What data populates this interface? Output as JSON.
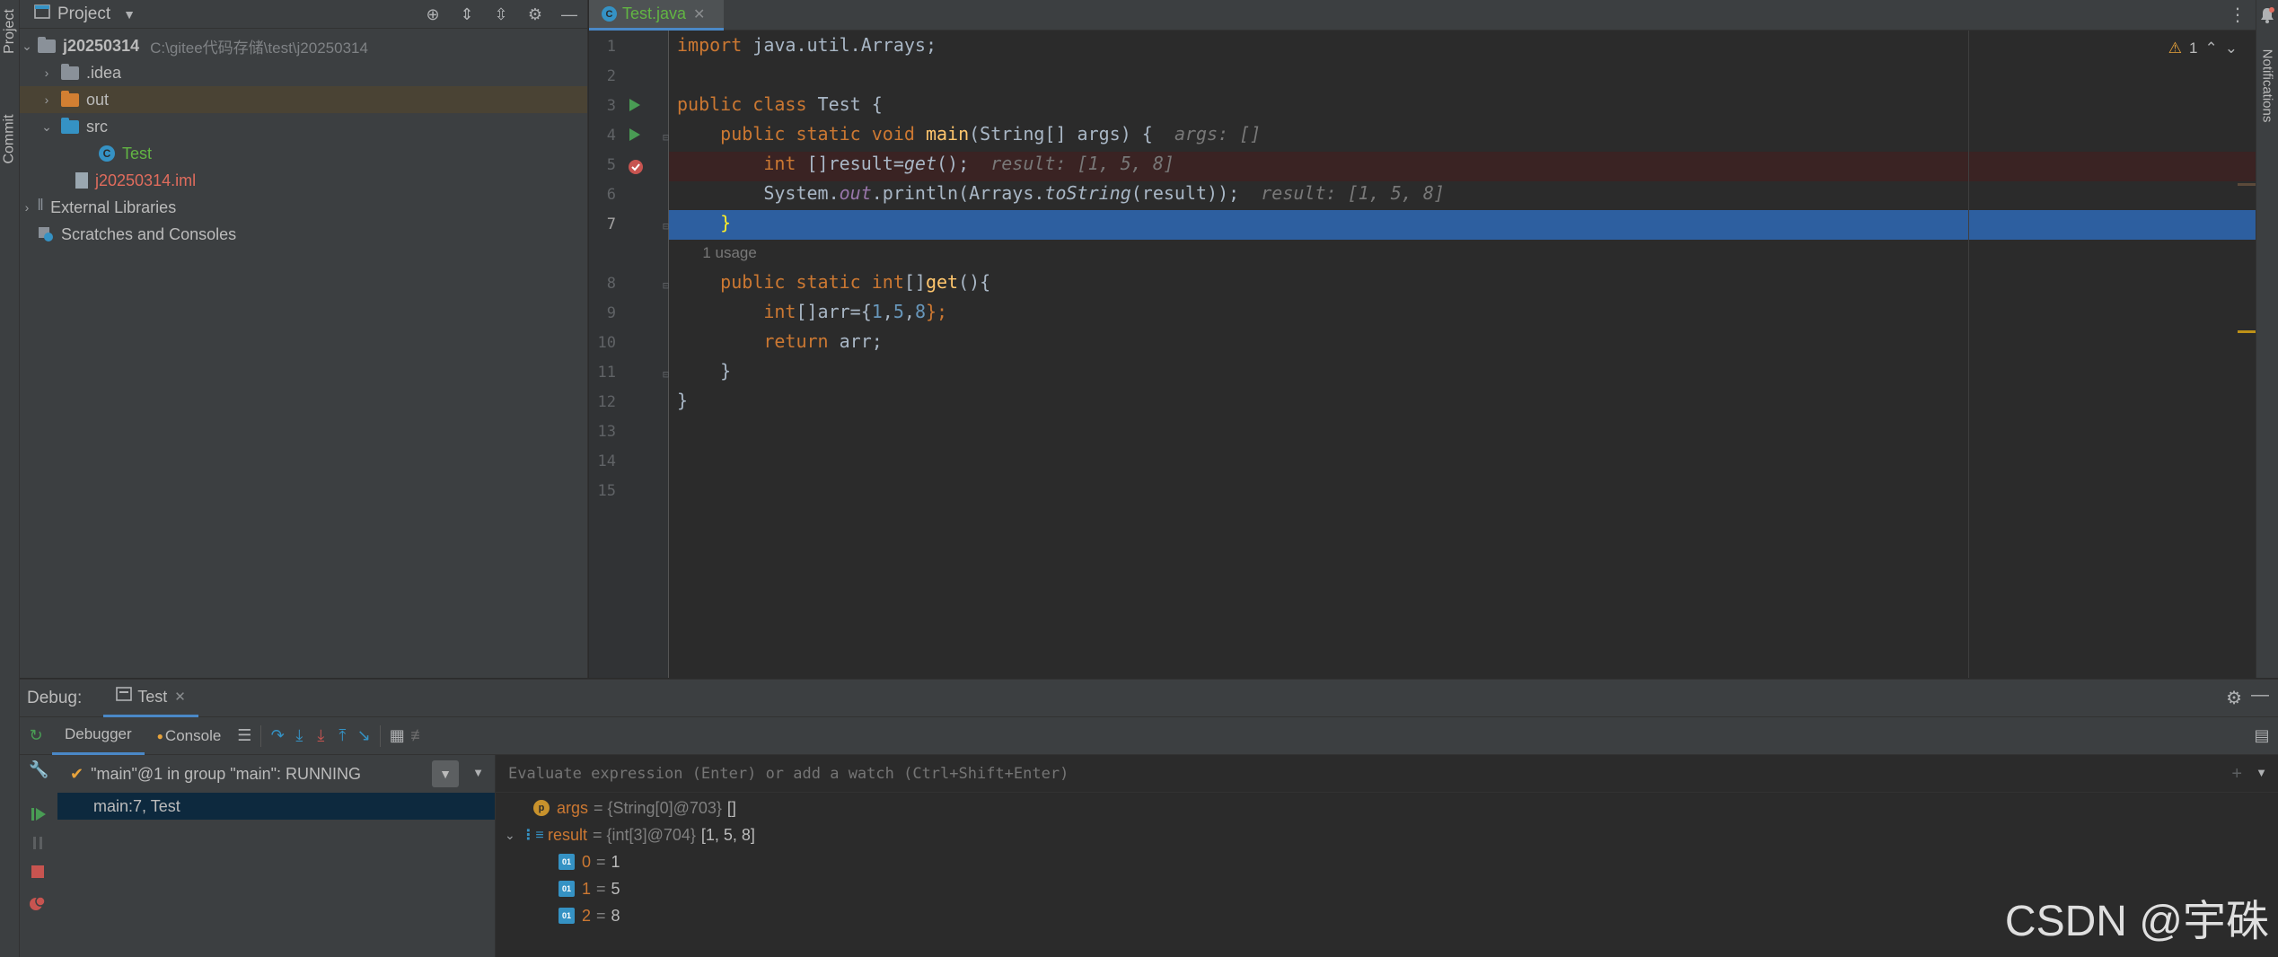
{
  "window": {
    "left_strip": {
      "project_tab": "Project",
      "commit_tab": "Commit"
    },
    "right_strip": {
      "notifications_tab": "Notifications"
    }
  },
  "project": {
    "header": {
      "title": "Project"
    },
    "tree": [
      {
        "label": "j20250314",
        "path": "C:\\gitee代码存储\\test\\j20250314",
        "color": "#bbbbbb"
      },
      {
        "label": ".idea",
        "color": "#bbbbbb"
      },
      {
        "label": "out",
        "color": "#bbbbbb"
      },
      {
        "label": "src",
        "color": "#bbbbbb"
      },
      {
        "label": "Test",
        "color": "#62b543"
      },
      {
        "label": "j20250314.iml",
        "color": "#e06c5d"
      },
      {
        "label": "External Libraries",
        "color": "#bbbbbb"
      },
      {
        "label": "Scratches and Consoles",
        "color": "#bbbbbb"
      }
    ]
  },
  "editor": {
    "tab": {
      "label": "Test.java"
    },
    "warnings": {
      "count": "1"
    },
    "line_numbers": [
      "1",
      "2",
      "3",
      "4",
      "5",
      "6",
      "7",
      "8",
      "9",
      "10",
      "11",
      "12",
      "13",
      "14",
      "15"
    ],
    "usage_hint": "1 usage",
    "code": {
      "l1_kw": "import",
      "l1_rest": " java.util.Arrays;",
      "l3_kw": "public class",
      "l3_rest": " Test {",
      "l4_kw": "public static void",
      "l4_fn": "main",
      "l4_rest": "(String[] args) {",
      "l4_hint": "args: []",
      "l5_kw": "int",
      "l5_rest": " []result=",
      "l5_call": "get",
      "l5_end": "();",
      "l5_hint": "result: [1, 5, 8]",
      "l6_a": "System.",
      "l6_out": "out",
      "l6_b": ".println(Arrays.",
      "l6_tostr": "toString",
      "l6_c": "(result));",
      "l6_hint": "result: [1, 5, 8]",
      "l7": "}",
      "l8_kw": "public static int",
      "l8_rest": "[]",
      "l8_fn": "get",
      "l8_end": "(){",
      "l9_kw": "int",
      "l9_a": "[]arr={",
      "l9_n1": "1",
      "l9_n2": "5",
      "l9_n3": "8",
      "l9_end": "};",
      "l10_kw": "return",
      "l10_rest": " arr;",
      "l11": "}",
      "l12": "}"
    }
  },
  "debug": {
    "title": "Debug:",
    "session_tab": "Test",
    "tabs": {
      "debugger": "Debugger",
      "console": "Console"
    },
    "thread": "\"main\"@1 in group \"main\": RUNNING",
    "frame": "main:7, Test",
    "eval_placeholder": "Evaluate expression (Enter) or add a watch (Ctrl+Shift+Enter)",
    "variables": [
      {
        "name": "args",
        "meta": "= {String[0]@703}",
        "value": "[]"
      },
      {
        "name": "result",
        "meta": "= {int[3]@704}",
        "value": "[1, 5, 8]"
      },
      {
        "name": "0",
        "meta": "=",
        "value": "1"
      },
      {
        "name": "1",
        "meta": "=",
        "value": "5"
      },
      {
        "name": "2",
        "meta": "=",
        "value": "8"
      }
    ]
  },
  "watermark": "CSDN @宇硃"
}
